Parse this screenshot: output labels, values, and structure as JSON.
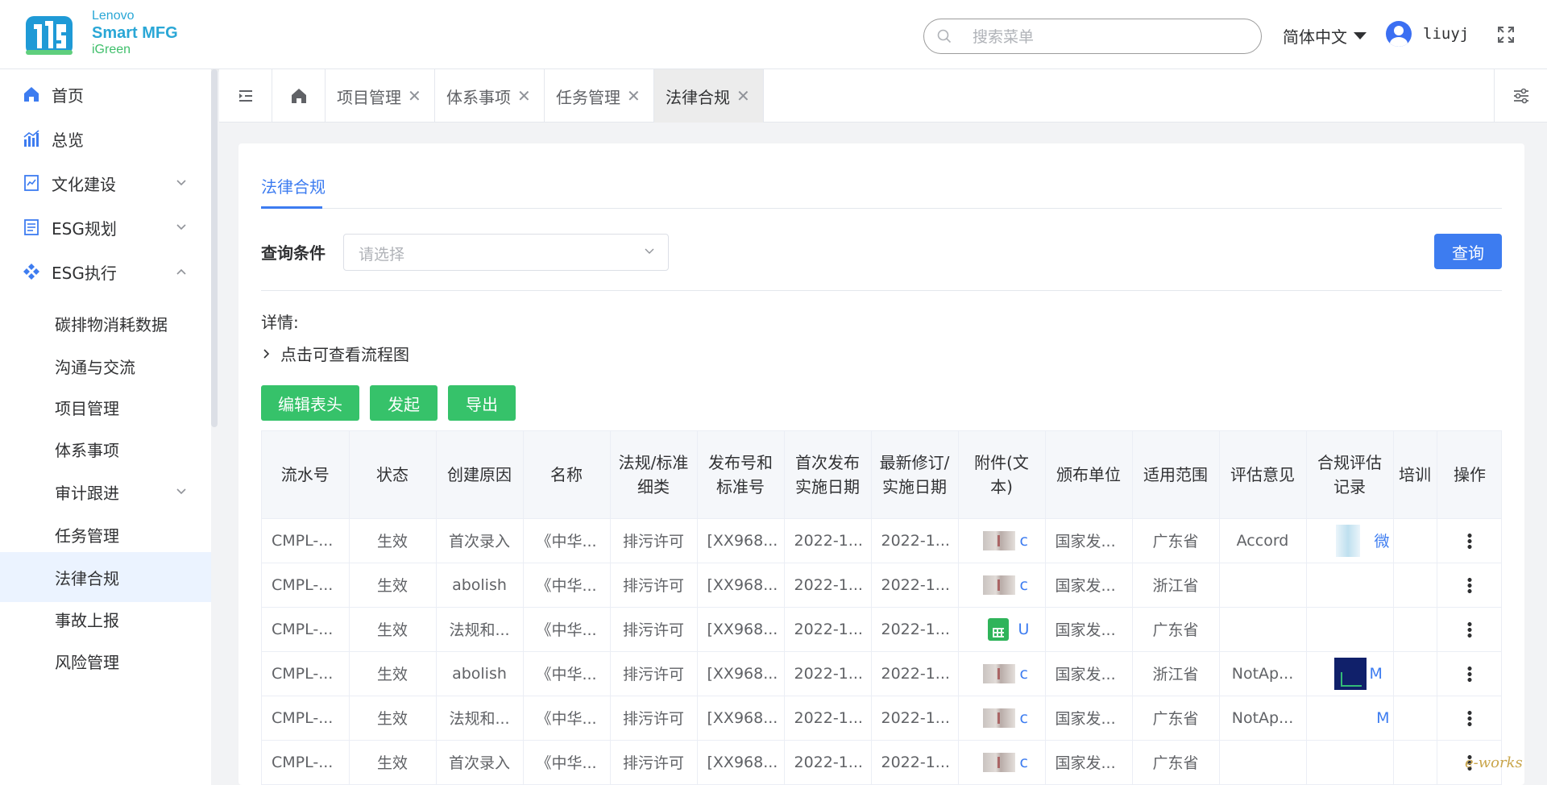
{
  "brand": {
    "line1": "Lenovo",
    "line2": "Smart MFG",
    "line3": "iGreen"
  },
  "header": {
    "search_placeholder": "搜索菜单",
    "language": "简体中文",
    "username": "liuyj"
  },
  "sidebar": {
    "items": [
      {
        "label": "首页"
      },
      {
        "label": "总览"
      },
      {
        "label": "文化建设"
      },
      {
        "label": "ESG规划"
      },
      {
        "label": "ESG执行"
      }
    ],
    "sub_items": [
      {
        "label": "碳排物消耗数据"
      },
      {
        "label": "沟通与交流"
      },
      {
        "label": "项目管理"
      },
      {
        "label": "体系事项"
      },
      {
        "label": "审计跟进"
      },
      {
        "label": "任务管理"
      },
      {
        "label": "法律合规"
      },
      {
        "label": "事故上报"
      },
      {
        "label": "风险管理"
      }
    ]
  },
  "tabs": [
    {
      "label": "项目管理",
      "close": "✕"
    },
    {
      "label": "体系事项",
      "close": "✕"
    },
    {
      "label": "任务管理",
      "close": "✕"
    },
    {
      "label": "法律合规",
      "close": "✕"
    }
  ],
  "page": {
    "inner_tab": "法律合规",
    "query_label": "查询条件",
    "query_placeholder": "请选择",
    "query_button": "查询",
    "detail_label": "详情:",
    "flow_toggle": "点击可查看流程图",
    "actions": {
      "edit": "编辑表头",
      "launch": "发起",
      "export": "导出"
    }
  },
  "table": {
    "headers": [
      "流水号",
      "状态",
      "创建原因",
      "名称",
      "法规/标准细类",
      "发布号和标准号",
      "首次发布实施日期",
      "最新修订/实施日期",
      "附件(文本)",
      "颁布单位",
      "适用范围",
      "评估意见",
      "合规评估记录",
      "培训",
      "操作"
    ],
    "rows": [
      {
        "id": "CMPL-...",
        "status": "生效",
        "reason": "首次录入",
        "name": "《中华...",
        "category": "排污许可",
        "number": "[XX968...",
        "first_date": "2022-1...",
        "latest_date": "2022-1...",
        "attachment": "c",
        "issuer": "国家发...",
        "scope": "广东省",
        "opinion": "Accord",
        "record": "微"
      },
      {
        "id": "CMPL-...",
        "status": "生效",
        "reason": "abolish",
        "name": "《中华...",
        "category": "排污许可",
        "number": "[XX968...",
        "first_date": "2022-1...",
        "latest_date": "2022-1...",
        "attachment": "c",
        "issuer": "国家发...",
        "scope": "浙江省",
        "opinion": "",
        "record": ""
      },
      {
        "id": "CMPL-...",
        "status": "生效",
        "reason": "法规和...",
        "name": "《中华...",
        "category": "排污许可",
        "number": "[XX968...",
        "first_date": "2022-1...",
        "latest_date": "2022-1...",
        "attachment": "U",
        "issuer": "国家发...",
        "scope": "广东省",
        "opinion": "",
        "record": ""
      },
      {
        "id": "CMPL-...",
        "status": "生效",
        "reason": "abolish",
        "name": "《中华...",
        "category": "排污许可",
        "number": "[XX968...",
        "first_date": "2022-1...",
        "latest_date": "2022-1...",
        "attachment": "c",
        "issuer": "国家发...",
        "scope": "浙江省",
        "opinion": "NotAp...",
        "record": "M"
      },
      {
        "id": "CMPL-...",
        "status": "生效",
        "reason": "法规和...",
        "name": "《中华...",
        "category": "排污许可",
        "number": "[XX968...",
        "first_date": "2022-1...",
        "latest_date": "2022-1...",
        "attachment": "c",
        "issuer": "国家发...",
        "scope": "广东省",
        "opinion": "NotAp...",
        "record": "M"
      },
      {
        "id": "CMPL-...",
        "status": "生效",
        "reason": "首次录入",
        "name": "《中华...",
        "category": "排污许可",
        "number": "[XX968...",
        "first_date": "2022-1...",
        "latest_date": "2022-1...",
        "attachment": "c",
        "issuer": "国家发...",
        "scope": "广东省",
        "opinion": "",
        "record": ""
      }
    ]
  },
  "watermark": "e-works",
  "colors": {
    "primary": "#3d7cf0",
    "success": "#36c26a",
    "brand": "#2aa7d6",
    "brand_green": "#3fbf6b"
  }
}
